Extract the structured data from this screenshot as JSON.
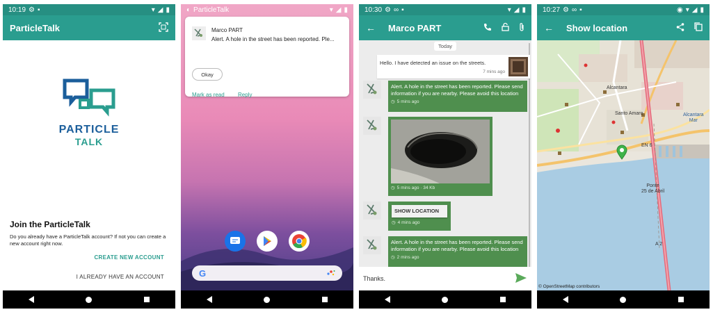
{
  "screen1": {
    "status_time": "10:19",
    "app_title": "ParticleTalk",
    "logo_line1": "PARTICLE",
    "logo_line2": "TALK",
    "join_title": "Join the ParticleTalk",
    "join_desc": "Do you already have a ParticleTalk account? If not you can create a new account right now.",
    "create_button": "CREATE NEW ACCOUNT",
    "have_button": "I ALREADY HAVE AN ACCOUNT"
  },
  "screen2": {
    "notif_app": "ParticleTalk",
    "notif_sender": "Marco PART",
    "notif_message": "Alert.  A hole in the street has been reported.  Ple...",
    "okay_button": "Okay",
    "mark_read": "Mark as read",
    "reply": "Reply"
  },
  "screen3": {
    "status_time": "10:30",
    "contact_name": "Marco PART",
    "date_chip": "Today",
    "outgoing": {
      "text": "Hello. I have detected an issue on the streets.",
      "time": "7 mins ago"
    },
    "messages": [
      {
        "text": "Alert.  A hole in the street has been reported.  Please send information if you are nearby.  Please avoid this location",
        "meta": "5 mins ago"
      },
      {
        "meta": "5 mins ago · 34 Kb"
      },
      {
        "button": "SHOW LOCATION",
        "meta": "4 mins ago"
      },
      {
        "text": "Alert.  A hole in the street has been reported.  Please send information if you are nearby.  Please avoid this location",
        "meta": "2 mins ago"
      }
    ],
    "input_value": "Thanks."
  },
  "screen4": {
    "status_time": "10:27",
    "title": "Show location",
    "labels": {
      "bridge": "Ponte\n25 de Abril",
      "santo_amaro": "Santo Amaro",
      "alcantara": "Alcantara",
      "alcantara_mar": "Alcantara\nMar",
      "road_en6": "EN 6",
      "road_a2": "A 2"
    },
    "credit": "© OpenStreetMap contributors"
  },
  "colors": {
    "teal": "#2a9d8f",
    "bubble_green": "#4f8f4e",
    "accent_green": "#5aaa5a"
  }
}
